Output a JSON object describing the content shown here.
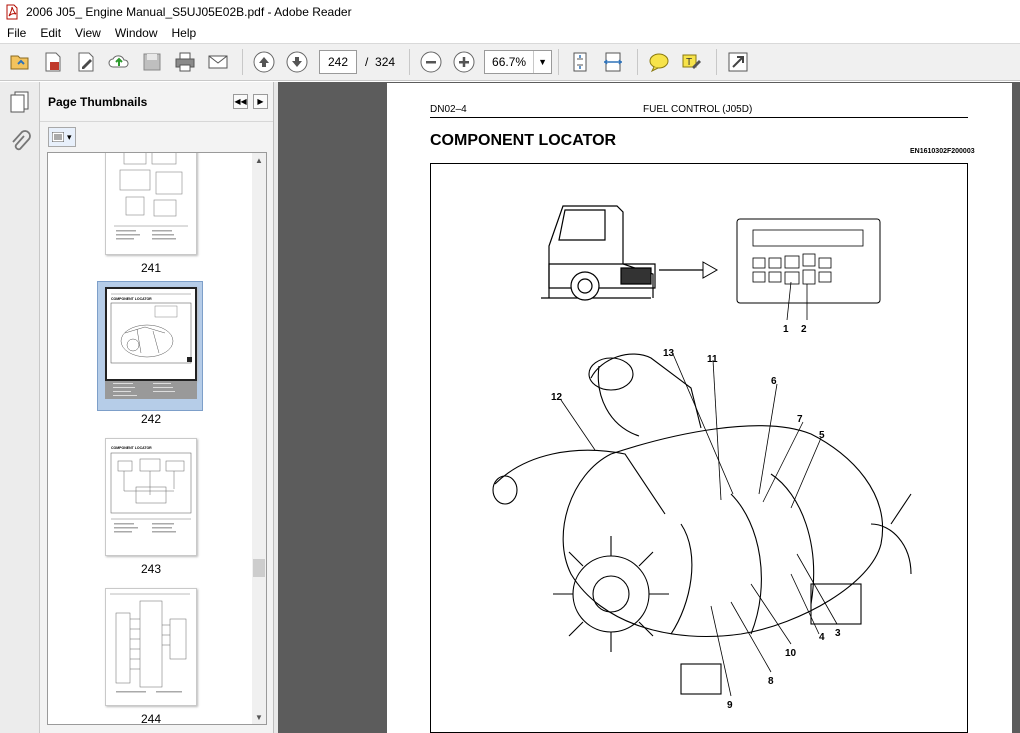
{
  "window": {
    "title": "2006 J05_ Engine Manual_S5UJ05E02B.pdf - Adobe Reader"
  },
  "menu": {
    "items": [
      "File",
      "Edit",
      "View",
      "Window",
      "Help"
    ]
  },
  "toolbar": {
    "current_page": "242",
    "page_separator": "/",
    "total_pages": "324",
    "zoom": "66.7%",
    "icons": [
      "open-icon",
      "create-pdf-icon",
      "edit-icon",
      "upload-icon",
      "save-icon",
      "print-icon",
      "email-icon",
      "previous-page-icon",
      "next-page-icon",
      "zoom-out-icon",
      "zoom-in-icon",
      "fit-page-icon",
      "fit-width-icon",
      "comment-icon",
      "highlight-icon",
      "expand-icon"
    ]
  },
  "thumbnails_panel": {
    "title": "Page Thumbnails",
    "pages": [
      {
        "label": "241",
        "title": ""
      },
      {
        "label": "242",
        "title": "COMPONENT LOCATOR",
        "selected": true
      },
      {
        "label": "243",
        "title": "COMPONENT LOCATOR"
      },
      {
        "label": "244",
        "title": ""
      }
    ]
  },
  "document_page": {
    "header_left": "DN02–4",
    "header_center": "FUEL CONTROL (J05D)",
    "title": "COMPONENT LOCATOR",
    "code": "EN1610302F200003",
    "callouts": [
      "1",
      "2",
      "3",
      "4",
      "5",
      "6",
      "7",
      "8",
      "9",
      "10",
      "11",
      "12",
      "13"
    ]
  },
  "colors": {
    "doc_background": "#5c5c5c",
    "selection": "#b6cde8",
    "toolbar": "#f0f0f0"
  }
}
